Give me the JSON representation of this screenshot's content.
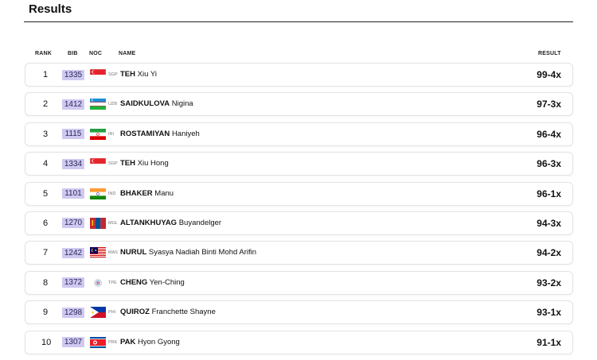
{
  "page": {
    "title": "Results"
  },
  "columns": {
    "rank": "RANK",
    "bib": "BIB",
    "noc": "NOC",
    "name": "NAME",
    "result": "RESULT"
  },
  "rows": [
    {
      "rank": "1",
      "bib": "1335",
      "noc": "SGP",
      "last": "TEH",
      "first": "Xiu Yi",
      "result": "99-4x",
      "flag": "sgp-flag"
    },
    {
      "rank": "2",
      "bib": "1412",
      "noc": "UZB",
      "last": "SAIDKULOVA",
      "first": "Nigina",
      "result": "97-3x",
      "flag": "uzb-flag"
    },
    {
      "rank": "3",
      "bib": "1115",
      "noc": "IRI",
      "last": "ROSTAMIYAN",
      "first": "Haniyeh",
      "result": "96-4x",
      "flag": "iri-flag"
    },
    {
      "rank": "4",
      "bib": "1334",
      "noc": "SGP",
      "last": "TEH",
      "first": "Xiu Hong",
      "result": "96-3x",
      "flag": "sgp-flag"
    },
    {
      "rank": "5",
      "bib": "1101",
      "noc": "IND",
      "last": "BHAKER",
      "first": "Manu",
      "result": "96-1x",
      "flag": "ind-flag"
    },
    {
      "rank": "6",
      "bib": "1270",
      "noc": "MGL",
      "last": "ALTANKHUYAG",
      "first": "Buyandelger",
      "result": "94-3x",
      "flag": "mgl-flag"
    },
    {
      "rank": "7",
      "bib": "1242",
      "noc": "MAS",
      "last": "NURUL",
      "first": "Syasya Nadiah Binti Mohd Arifin",
      "result": "94-2x",
      "flag": "mas-flag"
    },
    {
      "rank": "8",
      "bib": "1372",
      "noc": "TPE",
      "last": "CHENG",
      "first": "Yen-Ching",
      "result": "93-2x",
      "flag": "tpe-flag"
    },
    {
      "rank": "9",
      "bib": "1298",
      "noc": "PHI",
      "last": "QUIROZ",
      "first": "Franchette Shayne",
      "result": "93-1x",
      "flag": "phi-flag"
    },
    {
      "rank": "10",
      "bib": "1307",
      "noc": "PRK",
      "last": "PAK",
      "first": "Hyon Gyong",
      "result": "91-1x",
      "flag": "prk-flag"
    }
  ],
  "colors": {
    "bib_bg": "#cfc8f0",
    "text": "#111111",
    "row_border": "#e3e3e3"
  }
}
